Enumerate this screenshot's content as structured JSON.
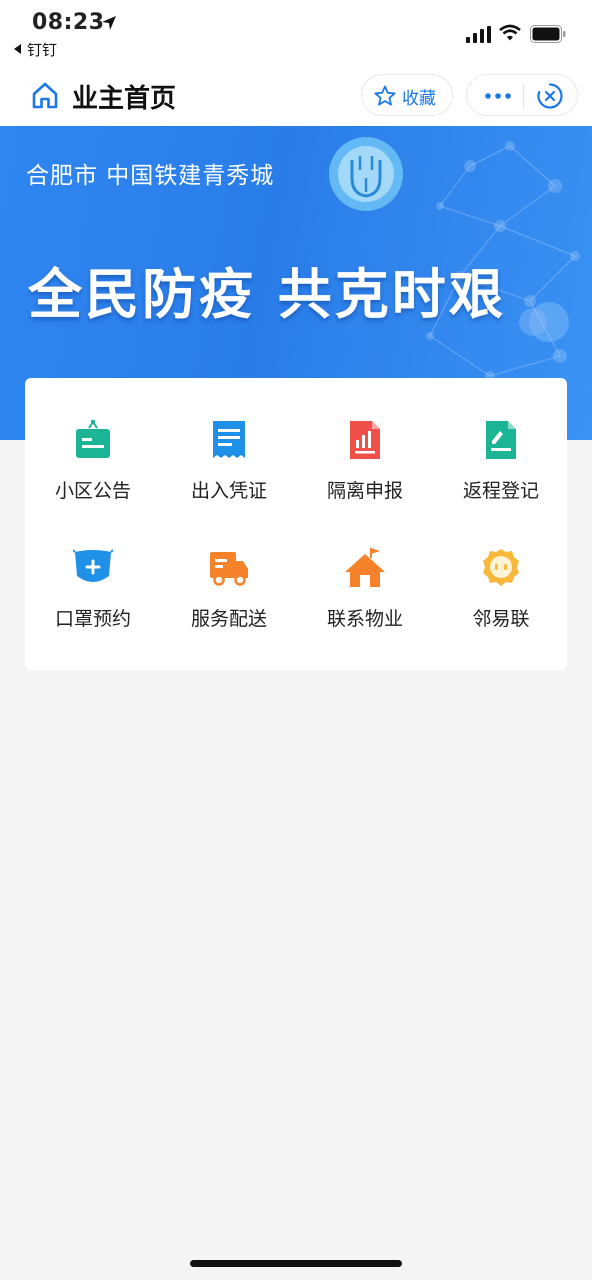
{
  "status_bar": {
    "time": "08:23",
    "back_app": "钉钉",
    "icons": [
      "location-arrow-icon",
      "cellular-signal-icon",
      "wifi-icon",
      "battery-icon"
    ]
  },
  "nav": {
    "title": "业主首页",
    "favorite_label": "收藏",
    "icons": [
      "home-icon",
      "star-icon",
      "more-icon",
      "close-icon"
    ]
  },
  "banner": {
    "city": "合肥市 中国铁建青秀城",
    "slogan": "全民防疫 共克时艰"
  },
  "grid": {
    "items": [
      {
        "label": "小区公告",
        "icon": "announcement-board-icon",
        "color": "#1bb596"
      },
      {
        "label": "出入凭证",
        "icon": "pass-document-icon",
        "color": "#1e90e8"
      },
      {
        "label": "隔离申报",
        "icon": "report-chart-icon",
        "color": "#f0504a"
      },
      {
        "label": "返程登记",
        "icon": "register-edit-icon",
        "color": "#1bb596"
      },
      {
        "label": "口罩预约",
        "icon": "mask-icon",
        "color": "#1e90e8"
      },
      {
        "label": "服务配送",
        "icon": "delivery-truck-icon",
        "color": "#f6822c"
      },
      {
        "label": "联系物业",
        "icon": "house-flag-icon",
        "color": "#f6822c"
      },
      {
        "label": "邻易联",
        "icon": "smiley-badge-icon",
        "color": "#f7b83b"
      }
    ]
  },
  "colors": {
    "accent": "#1a78ea",
    "banner": "#2f86f0",
    "background": "#f5f5f6"
  }
}
